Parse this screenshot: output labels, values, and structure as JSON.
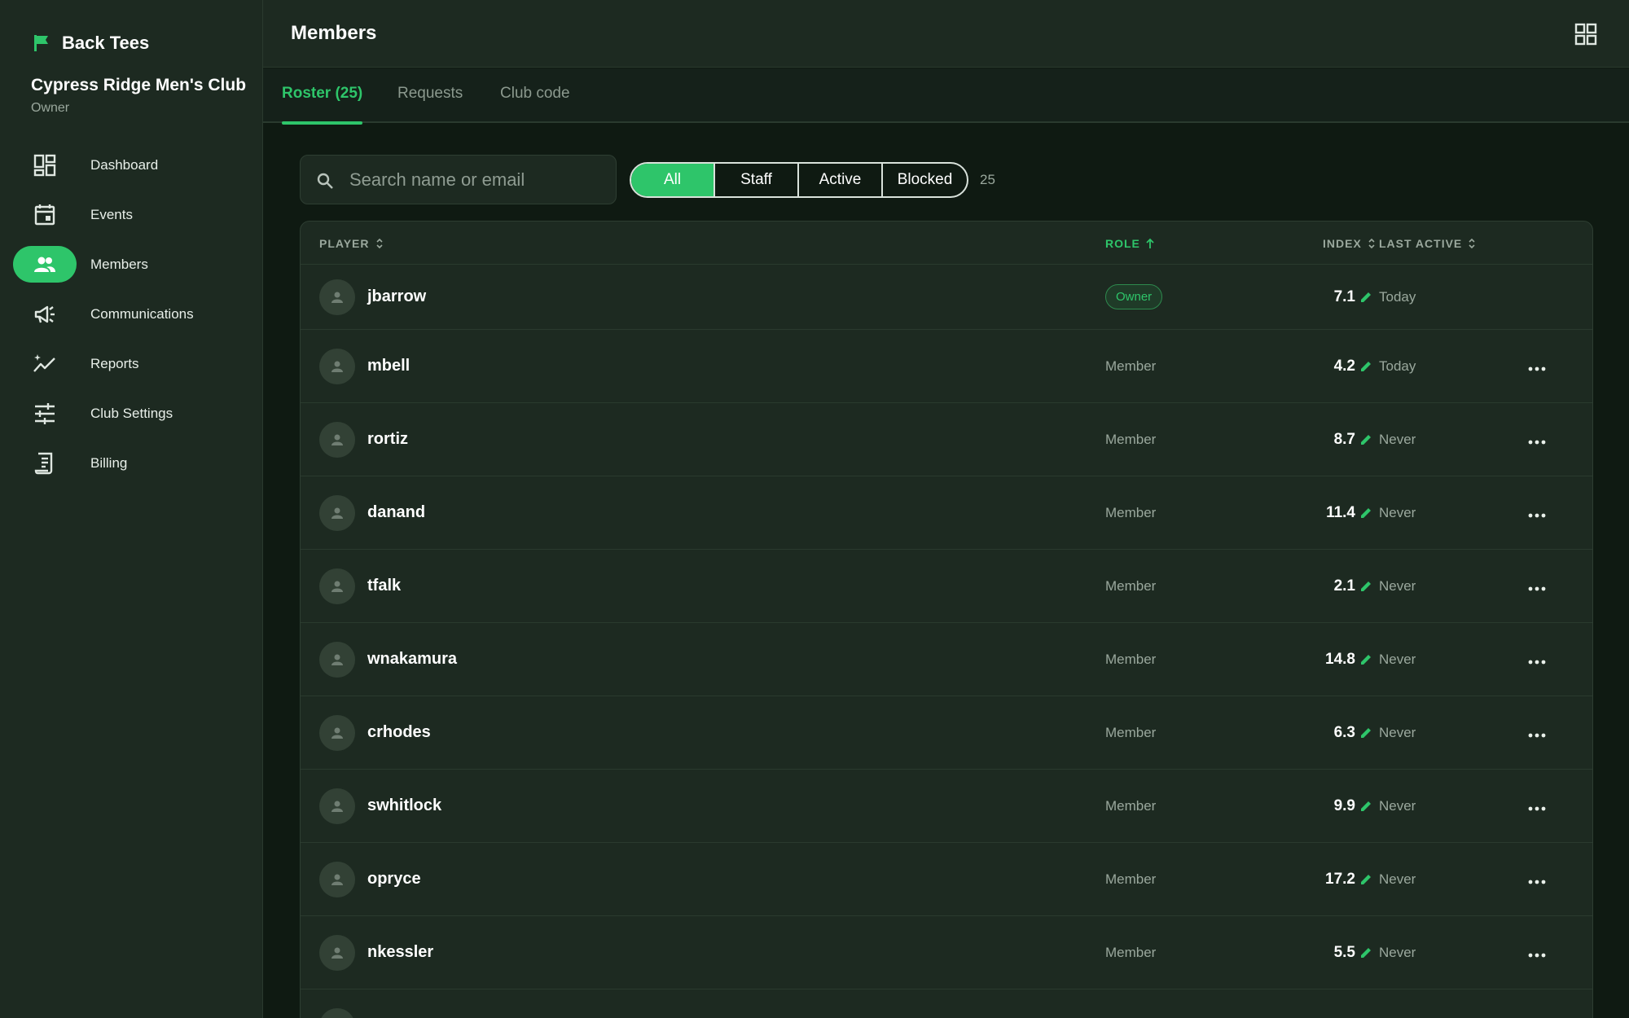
{
  "brand": {
    "name": "Back Tees",
    "accent": "#2ec56a"
  },
  "club": {
    "name": "Cypress Ridge Men's Club",
    "role": "Owner"
  },
  "sidebar": {
    "items": [
      {
        "label": "Dashboard",
        "icon": "dashboard-icon"
      },
      {
        "label": "Events",
        "icon": "calendar-icon"
      },
      {
        "label": "Members",
        "icon": "people-icon",
        "active": true
      },
      {
        "label": "Communications",
        "icon": "megaphone-icon"
      },
      {
        "label": "Reports",
        "icon": "trending-icon"
      },
      {
        "label": "Club Settings",
        "icon": "sliders-icon"
      },
      {
        "label": "Billing",
        "icon": "receipt-icon"
      }
    ]
  },
  "header": {
    "title": "Members",
    "grid_icon": "grid-icon"
  },
  "tabs": [
    {
      "label": "Roster (25)",
      "active": true
    },
    {
      "label": "Requests"
    },
    {
      "label": "Club code"
    }
  ],
  "search": {
    "placeholder": "Search name or email",
    "value": ""
  },
  "filters": [
    {
      "label": "All",
      "active": true
    },
    {
      "label": "Staff"
    },
    {
      "label": "Active"
    },
    {
      "label": "Blocked"
    }
  ],
  "count": "25",
  "table": {
    "columns": {
      "player": "PLAYER",
      "role": "ROLE",
      "index": "INDEX",
      "last_active": "LAST ACTIVE"
    },
    "sorted_column": "role",
    "rows": [
      {
        "player": "jbarrow",
        "role": "Owner",
        "index": "7.1",
        "last_active": "Today"
      },
      {
        "player": "mbell",
        "role": "Member",
        "index": "4.2",
        "last_active": "Today"
      },
      {
        "player": "rortiz",
        "role": "Member",
        "index": "8.7",
        "last_active": "Never"
      },
      {
        "player": "danand",
        "role": "Member",
        "index": "11.4",
        "last_active": "Never"
      },
      {
        "player": "tfalk",
        "role": "Member",
        "index": "2.1",
        "last_active": "Never"
      },
      {
        "player": "wnakamura",
        "role": "Member",
        "index": "14.8",
        "last_active": "Never"
      },
      {
        "player": "crhodes",
        "role": "Member",
        "index": "6.3",
        "last_active": "Never"
      },
      {
        "player": "swhitlock",
        "role": "Member",
        "index": "9.9",
        "last_active": "Never"
      },
      {
        "player": "opryce",
        "role": "Member",
        "index": "17.2",
        "last_active": "Never"
      },
      {
        "player": "nkessler",
        "role": "Member",
        "index": "5.5",
        "last_active": "Never"
      }
    ]
  }
}
